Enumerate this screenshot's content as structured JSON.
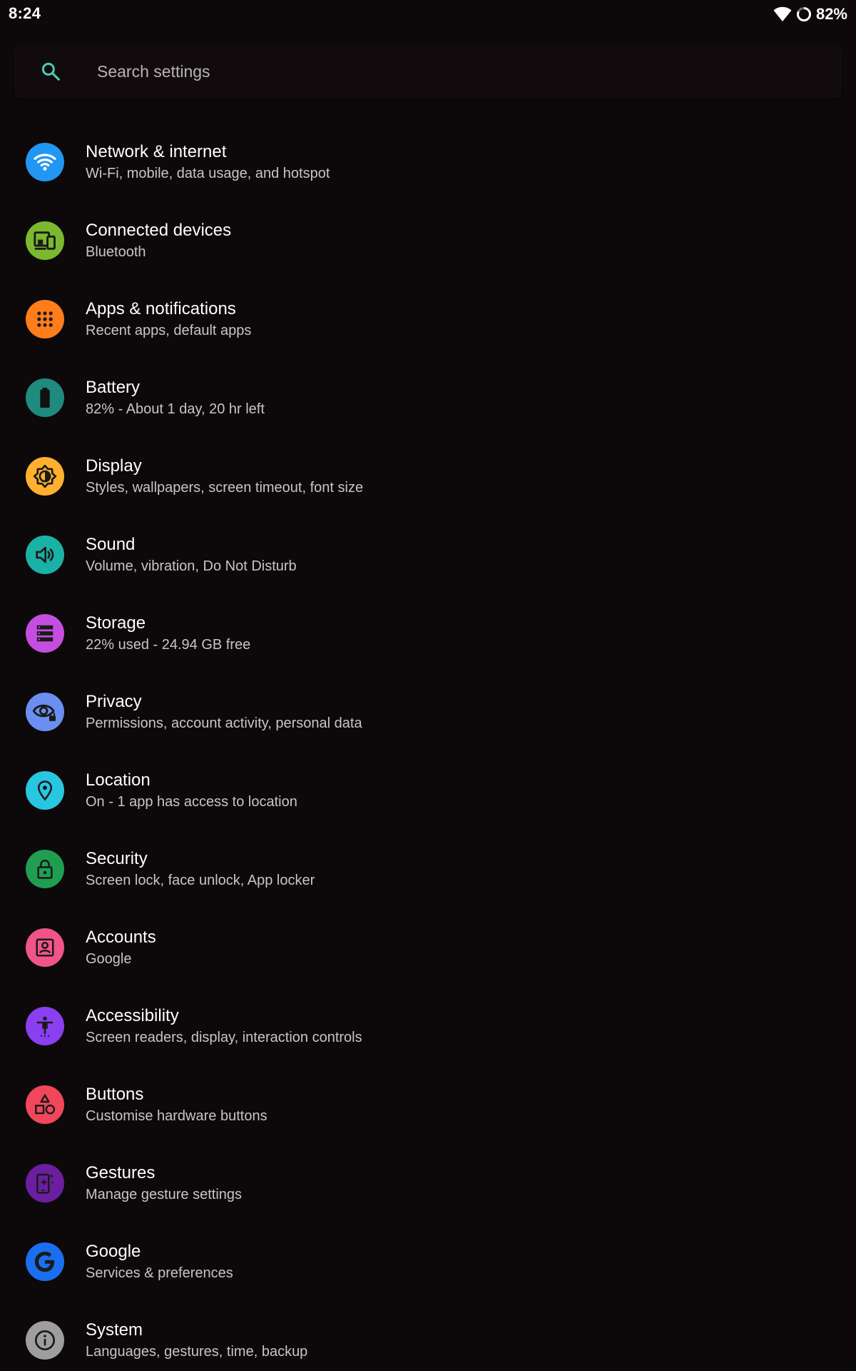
{
  "status_bar": {
    "time": "8:24",
    "battery_percent": "82%",
    "icons": [
      "wifi-icon",
      "battery-icon"
    ]
  },
  "search": {
    "placeholder": "Search settings",
    "icon": "search-icon"
  },
  "settings": [
    {
      "key": "network",
      "title": "Network & internet",
      "subtitle": "Wi-Fi, mobile, data usage, and hotspot",
      "icon": "wifi-icon",
      "color": "#2196f3"
    },
    {
      "key": "connected-devices",
      "title": "Connected devices",
      "subtitle": "Bluetooth",
      "icon": "devices-icon",
      "color": "#7cb82f"
    },
    {
      "key": "apps",
      "title": "Apps & notifications",
      "subtitle": "Recent apps, default apps",
      "icon": "apps-grid-icon",
      "color": "#ff7d1a"
    },
    {
      "key": "battery",
      "title": "Battery",
      "subtitle": "82% - About 1 day, 20 hr left",
      "icon": "battery-icon",
      "color": "#1f8a7e"
    },
    {
      "key": "display",
      "title": "Display",
      "subtitle": "Styles, wallpapers, screen timeout, font size",
      "icon": "brightness-icon",
      "color": "#ffb02e"
    },
    {
      "key": "sound",
      "title": "Sound",
      "subtitle": "Volume, vibration, Do Not Disturb",
      "icon": "volume-icon",
      "color": "#1ab2a6"
    },
    {
      "key": "storage",
      "title": "Storage",
      "subtitle": "22% used - 24.94 GB free",
      "icon": "storage-icon",
      "color": "#c54ee0"
    },
    {
      "key": "privacy",
      "title": "Privacy",
      "subtitle": "Permissions, account activity, personal data",
      "icon": "eye-lock-icon",
      "color": "#6b8ff0"
    },
    {
      "key": "location",
      "title": "Location",
      "subtitle": "On - 1 app has access to location",
      "icon": "location-pin-icon",
      "color": "#29c6e0"
    },
    {
      "key": "security",
      "title": "Security",
      "subtitle": "Screen lock, face unlock, App locker",
      "icon": "lock-icon",
      "color": "#1f9e52"
    },
    {
      "key": "accounts",
      "title": "Accounts",
      "subtitle": "Google",
      "icon": "account-box-icon",
      "color": "#f0548a"
    },
    {
      "key": "accessibility",
      "title": "Accessibility",
      "subtitle": "Screen readers, display, interaction controls",
      "icon": "accessibility-icon",
      "color": "#8a3ff0"
    },
    {
      "key": "buttons",
      "title": "Buttons",
      "subtitle": "Customise hardware buttons",
      "icon": "shapes-icon",
      "color": "#f0475a"
    },
    {
      "key": "gestures",
      "title": "Gestures",
      "subtitle": "Manage gesture settings",
      "icon": "gesture-phone-icon",
      "color": "#6b1fa0"
    },
    {
      "key": "google",
      "title": "Google",
      "subtitle": "Services & preferences",
      "icon": "google-icon",
      "color": "#1a6ef0"
    },
    {
      "key": "system",
      "title": "System",
      "subtitle": "Languages, gestures, time, backup",
      "icon": "info-icon",
      "color": "#9e9e9e"
    }
  ]
}
